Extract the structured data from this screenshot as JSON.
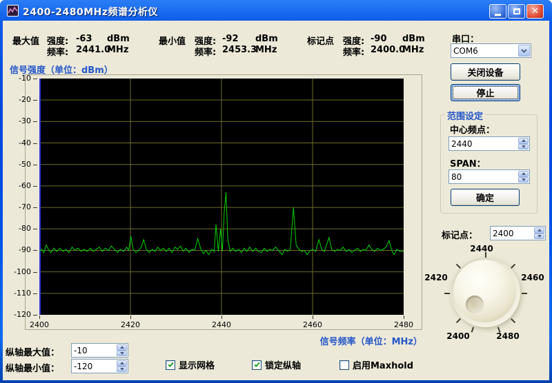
{
  "window": {
    "title": "2400-2480MHz频谱分析仪"
  },
  "readouts": {
    "max": {
      "label": "最大值",
      "strength_label": "强度:",
      "strength": "-63",
      "strength_unit": "dBm",
      "freq_label": "频率:",
      "freq": "2441.0",
      "freq_unit": "MHz"
    },
    "min": {
      "label": "最小值",
      "strength_label": "强度:",
      "strength": "-92",
      "strength_unit": "dBm",
      "freq_label": "频率:",
      "freq": "2453.3",
      "freq_unit": "MHz"
    },
    "marker": {
      "label": "标记点",
      "strength_label": "强度:",
      "strength": "-90",
      "strength_unit": "dBm",
      "freq_label": "频率:",
      "freq": "2400.0",
      "freq_unit": "MHz"
    }
  },
  "serial": {
    "label": "串口：",
    "value": "COM6"
  },
  "buttons": {
    "close_device": "关闭设备",
    "stop": "停止",
    "confirm": "确定"
  },
  "range": {
    "title": "范围设定",
    "center_label": "中心频点：",
    "center_value": "2440",
    "span_label": "SPAN：",
    "span_value": "80"
  },
  "marker_control": {
    "label": "标记点：",
    "value": "2400",
    "dial_labels": [
      "2440",
      "2420",
      "2460",
      "2400",
      "2480"
    ]
  },
  "axis_controls": {
    "ymax_label": "纵轴最大值：",
    "ymax_value": "-10",
    "ymin_label": "纵轴最小值：",
    "ymin_value": "-120"
  },
  "checkboxes": [
    {
      "label": "显示网格",
      "checked": true
    },
    {
      "label": "锁定纵轴",
      "checked": true
    },
    {
      "label": "启用Maxhold",
      "checked": false
    }
  ],
  "colors": {
    "accent_blue": "#2456c8",
    "titlebar_blue": "#0054e3",
    "client_bg": "#ece9d8",
    "plot_bg": "#000000",
    "trace_green": "#00d300",
    "grid_olive": "#6e6e28",
    "axis_blue": "#3434d8",
    "check_green": "#21a121"
  },
  "chart_data": {
    "type": "line",
    "title": "信号强度（单位：dBm）",
    "xlabel": "信号频率（单位：MHz）",
    "xlim": [
      2400,
      2480
    ],
    "ylim": [
      -120,
      -10
    ],
    "x_ticks": [
      2400,
      2420,
      2440,
      2460,
      2480
    ],
    "y_ticks": [
      -10,
      -20,
      -30,
      -40,
      -50,
      -60,
      -70,
      -80,
      -90,
      -100,
      -110,
      -120
    ],
    "grid": true,
    "legend": "none",
    "series": [
      {
        "name": "spectrum",
        "points": [
          [
            2400.0,
            -90.5
          ],
          [
            2400.5,
            -89.5
          ],
          [
            2401.0,
            -91
          ],
          [
            2401.5,
            -87.5
          ],
          [
            2402.0,
            -89.5
          ],
          [
            2402.5,
            -91
          ],
          [
            2403.2,
            -89
          ],
          [
            2403.8,
            -90.5
          ],
          [
            2404.5,
            -89
          ],
          [
            2405.2,
            -90.5
          ],
          [
            2405.8,
            -89.5
          ],
          [
            2406.5,
            -91
          ],
          [
            2407.2,
            -88.5
          ],
          [
            2407.8,
            -90
          ],
          [
            2408.5,
            -89
          ],
          [
            2409.2,
            -90.5
          ],
          [
            2409.8,
            -89.5
          ],
          [
            2410.5,
            -90.5
          ],
          [
            2411.2,
            -89
          ],
          [
            2411.8,
            -90.5
          ],
          [
            2412.5,
            -89.5
          ],
          [
            2413.2,
            -88.5
          ],
          [
            2413.8,
            -90.5
          ],
          [
            2414.5,
            -89
          ],
          [
            2415.2,
            -90
          ],
          [
            2415.8,
            -88
          ],
          [
            2416.5,
            -89.5
          ],
          [
            2417.2,
            -91
          ],
          [
            2417.8,
            -89.5
          ],
          [
            2418.5,
            -90.5
          ],
          [
            2419.2,
            -88.5
          ],
          [
            2419.6,
            -90
          ],
          [
            2420.1,
            -83.5
          ],
          [
            2420.6,
            -89.5
          ],
          [
            2421.2,
            -91
          ],
          [
            2421.8,
            -90
          ],
          [
            2422.4,
            -88.5
          ],
          [
            2422.9,
            -85
          ],
          [
            2423.5,
            -89.5
          ],
          [
            2424.1,
            -91
          ],
          [
            2424.8,
            -89.5
          ],
          [
            2425.4,
            -90.5
          ],
          [
            2426.0,
            -88.5
          ],
          [
            2426.6,
            -90
          ],
          [
            2427.2,
            -89
          ],
          [
            2427.9,
            -90.5
          ],
          [
            2428.5,
            -89
          ],
          [
            2429.1,
            -91
          ],
          [
            2429.8,
            -88.5
          ],
          [
            2430.4,
            -89.5
          ],
          [
            2431.0,
            -88
          ],
          [
            2431.6,
            -90.5
          ],
          [
            2432.2,
            -89
          ],
          [
            2432.9,
            -91
          ],
          [
            2433.5,
            -89.5
          ],
          [
            2434.1,
            -90
          ],
          [
            2434.8,
            -84.5
          ],
          [
            2435.4,
            -89
          ],
          [
            2436.0,
            -91.5
          ],
          [
            2436.6,
            -90
          ],
          [
            2437.2,
            -92
          ],
          [
            2437.9,
            -89.5
          ],
          [
            2438.4,
            -90.5
          ],
          [
            2438.8,
            -78
          ],
          [
            2439.3,
            -90.5
          ],
          [
            2439.8,
            -80
          ],
          [
            2440.2,
            -90.5
          ],
          [
            2440.6,
            -72
          ],
          [
            2441.0,
            -63
          ],
          [
            2441.4,
            -85
          ],
          [
            2441.9,
            -90.5
          ],
          [
            2442.5,
            -89
          ],
          [
            2443.1,
            -90.5
          ],
          [
            2443.8,
            -89.5
          ],
          [
            2444.4,
            -91
          ],
          [
            2445.0,
            -89
          ],
          [
            2445.6,
            -90.5
          ],
          [
            2446.2,
            -88.5
          ],
          [
            2446.9,
            -90.5
          ],
          [
            2447.5,
            -89
          ],
          [
            2448.1,
            -90.5
          ],
          [
            2448.8,
            -91
          ],
          [
            2449.4,
            -89
          ],
          [
            2450.0,
            -90.5
          ],
          [
            2450.6,
            -89.5
          ],
          [
            2451.2,
            -90
          ],
          [
            2451.9,
            -88.5
          ],
          [
            2452.5,
            -90
          ],
          [
            2453.3,
            -92
          ],
          [
            2453.9,
            -89.5
          ],
          [
            2454.5,
            -90.5
          ],
          [
            2455.1,
            -89.5
          ],
          [
            2455.8,
            -70
          ],
          [
            2456.4,
            -87.5
          ],
          [
            2457.0,
            -89.5
          ],
          [
            2457.6,
            -90.5
          ],
          [
            2458.2,
            -90
          ],
          [
            2458.8,
            -92
          ],
          [
            2459.5,
            -90
          ],
          [
            2460.1,
            -89.5
          ],
          [
            2460.7,
            -90.5
          ],
          [
            2461.4,
            -85
          ],
          [
            2462.0,
            -89.5
          ],
          [
            2462.6,
            -90.5
          ],
          [
            2463.6,
            -84
          ],
          [
            2464.2,
            -89.5
          ],
          [
            2464.9,
            -90.5
          ],
          [
            2465.5,
            -89.5
          ],
          [
            2466.1,
            -90
          ],
          [
            2466.7,
            -88.5
          ],
          [
            2467.4,
            -90.5
          ],
          [
            2468.0,
            -89.5
          ],
          [
            2468.6,
            -91
          ],
          [
            2469.2,
            -90
          ],
          [
            2469.9,
            -89
          ],
          [
            2470.5,
            -90.5
          ],
          [
            2471.1,
            -89.5
          ],
          [
            2471.7,
            -90
          ],
          [
            2472.4,
            -87.5
          ],
          [
            2473.0,
            -89.5
          ],
          [
            2473.6,
            -90.5
          ],
          [
            2474.3,
            -89
          ],
          [
            2474.9,
            -90
          ],
          [
            2475.5,
            -89.5
          ],
          [
            2476.1,
            -88.5
          ],
          [
            2476.8,
            -85.5
          ],
          [
            2477.4,
            -90
          ],
          [
            2477.9,
            -92
          ],
          [
            2478.5,
            -89.5
          ],
          [
            2479.2,
            -90.5
          ],
          [
            2480.0,
            -90.5
          ]
        ]
      }
    ]
  }
}
